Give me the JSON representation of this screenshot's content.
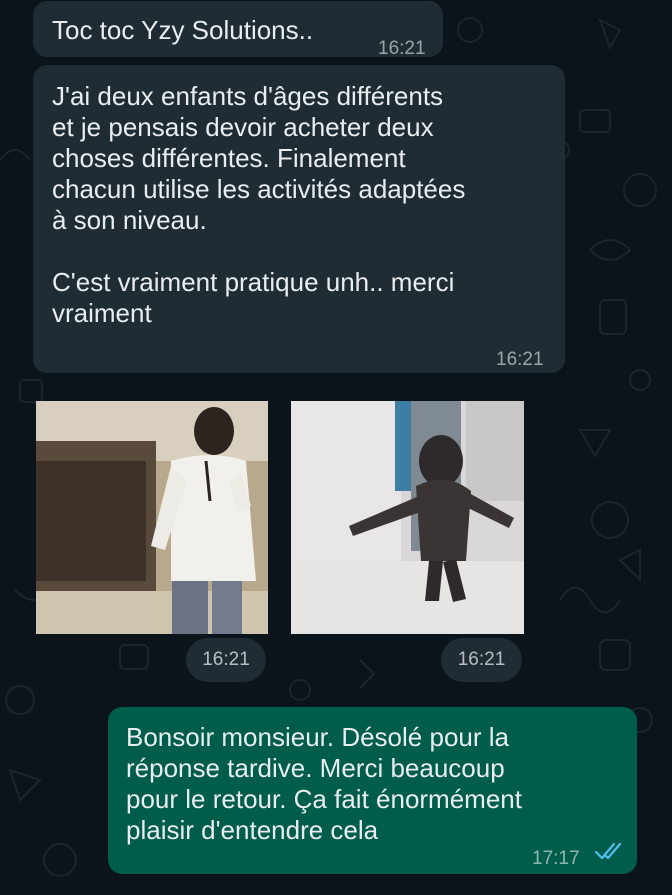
{
  "messages": [
    {
      "id": "m1",
      "direction": "incoming",
      "text": "Toc toc Yzy Solutions..",
      "time": "16:21"
    },
    {
      "id": "m2",
      "direction": "incoming",
      "text": "J'ai deux enfants d'âges différents\net je pensais devoir acheter deux\nchoses différentes. Finalement\nchacun utilise les activités adaptées\nà son niveau.\n\nC'est vraiment pratique unh.. merci\nvraiment",
      "time": "16:21"
    },
    {
      "id": "m3",
      "direction": "incoming",
      "type": "sticker",
      "icon": "dancing-man-sticker",
      "time": "16:21"
    },
    {
      "id": "m4",
      "direction": "incoming",
      "type": "sticker",
      "icon": "running-figure-sticker",
      "time": "16:21"
    },
    {
      "id": "m5",
      "direction": "outgoing",
      "text": "Bonsoir monsieur. Désolé pour la\nréponse tardive. Merci beaucoup\npour le retour. Ça fait énormément\nplaisir d'entendre cela",
      "time": "17:17",
      "status": "read",
      "status_icon": "double-check-icon"
    }
  ],
  "colors": {
    "background": "#0b141a",
    "incoming_bubble": "#1f2c34",
    "outgoing_bubble": "#005c4b",
    "read_ticks": "#53bdeb"
  }
}
